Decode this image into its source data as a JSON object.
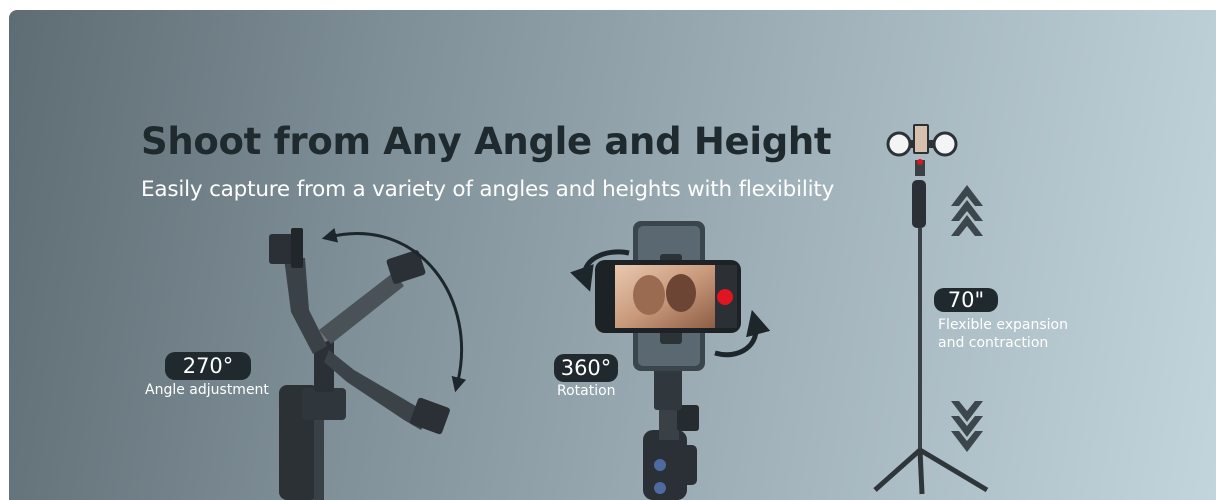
{
  "headline": "Shoot from Any Angle and Height",
  "subheadline": "Easily capture from a variety of angles and heights with flexibility",
  "features": [
    {
      "value": "270°",
      "label": "Angle adjustment"
    },
    {
      "value": "360°",
      "label": "Rotation"
    },
    {
      "value": "70\"",
      "label_line1": "Flexible expansion",
      "label_line2": "and contraction"
    }
  ],
  "colors": {
    "badge": "#1f292e",
    "accent_red": "#e0151f",
    "headline": "#1f2a2f"
  },
  "icons": [
    "rotate-arc-arrow-icon",
    "rotate-ccw-arrow-icon",
    "rotate-cw-arrow-icon",
    "extend-up-arrow-icon",
    "retract-down-arrow-icon",
    "record-button-icon"
  ]
}
